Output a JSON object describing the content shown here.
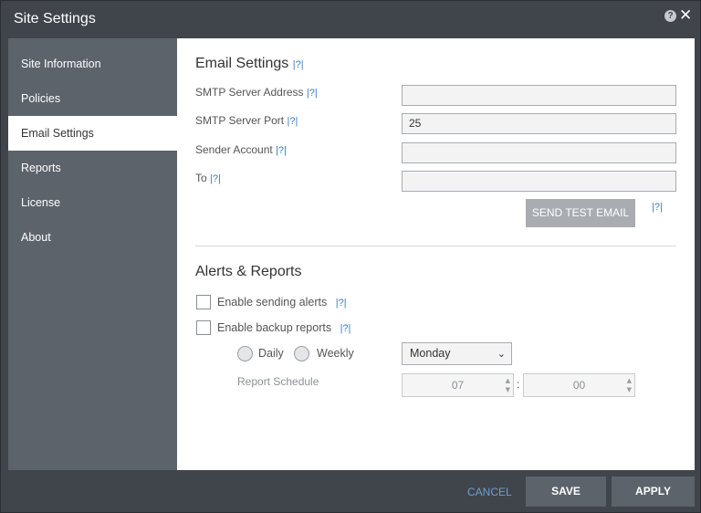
{
  "window": {
    "title": "Site Settings",
    "help_icon_text": "?",
    "close_icon": "close-icon"
  },
  "sidebar": {
    "items": [
      {
        "label": "Site Information",
        "active": false
      },
      {
        "label": "Policies",
        "active": false
      },
      {
        "label": "Email Settings",
        "active": true
      },
      {
        "label": "Reports",
        "active": false
      },
      {
        "label": "License",
        "active": false
      },
      {
        "label": "About",
        "active": false
      }
    ]
  },
  "help_link": "|?|",
  "email": {
    "title": "Email Settings",
    "fields": [
      {
        "label": "SMTP Server Address",
        "value": ""
      },
      {
        "label": "SMTP Server Port",
        "value": "25"
      },
      {
        "label": "Sender Account",
        "value": ""
      },
      {
        "label": "To",
        "value": ""
      }
    ],
    "send_test_label": "SEND TEST EMAIL"
  },
  "alerts": {
    "title": "Alerts & Reports",
    "enable_alerts_label": "Enable sending alerts",
    "enable_backup_label": "Enable backup reports",
    "daily_label": "Daily",
    "weekly_label": "Weekly",
    "day_select_value": "Monday",
    "schedule_label": "Report Schedule",
    "hour": "07",
    "minute": "00",
    "separator": ":"
  },
  "footer": {
    "cancel_label": "CANCEL",
    "save_label": "SAVE",
    "apply_label": "APPLY"
  },
  "colors": {
    "sidebar_bg": "#5d636b",
    "link": "#3b7bc0",
    "button_bg": "#5d636b",
    "disabled_button": "#a9adb2"
  }
}
